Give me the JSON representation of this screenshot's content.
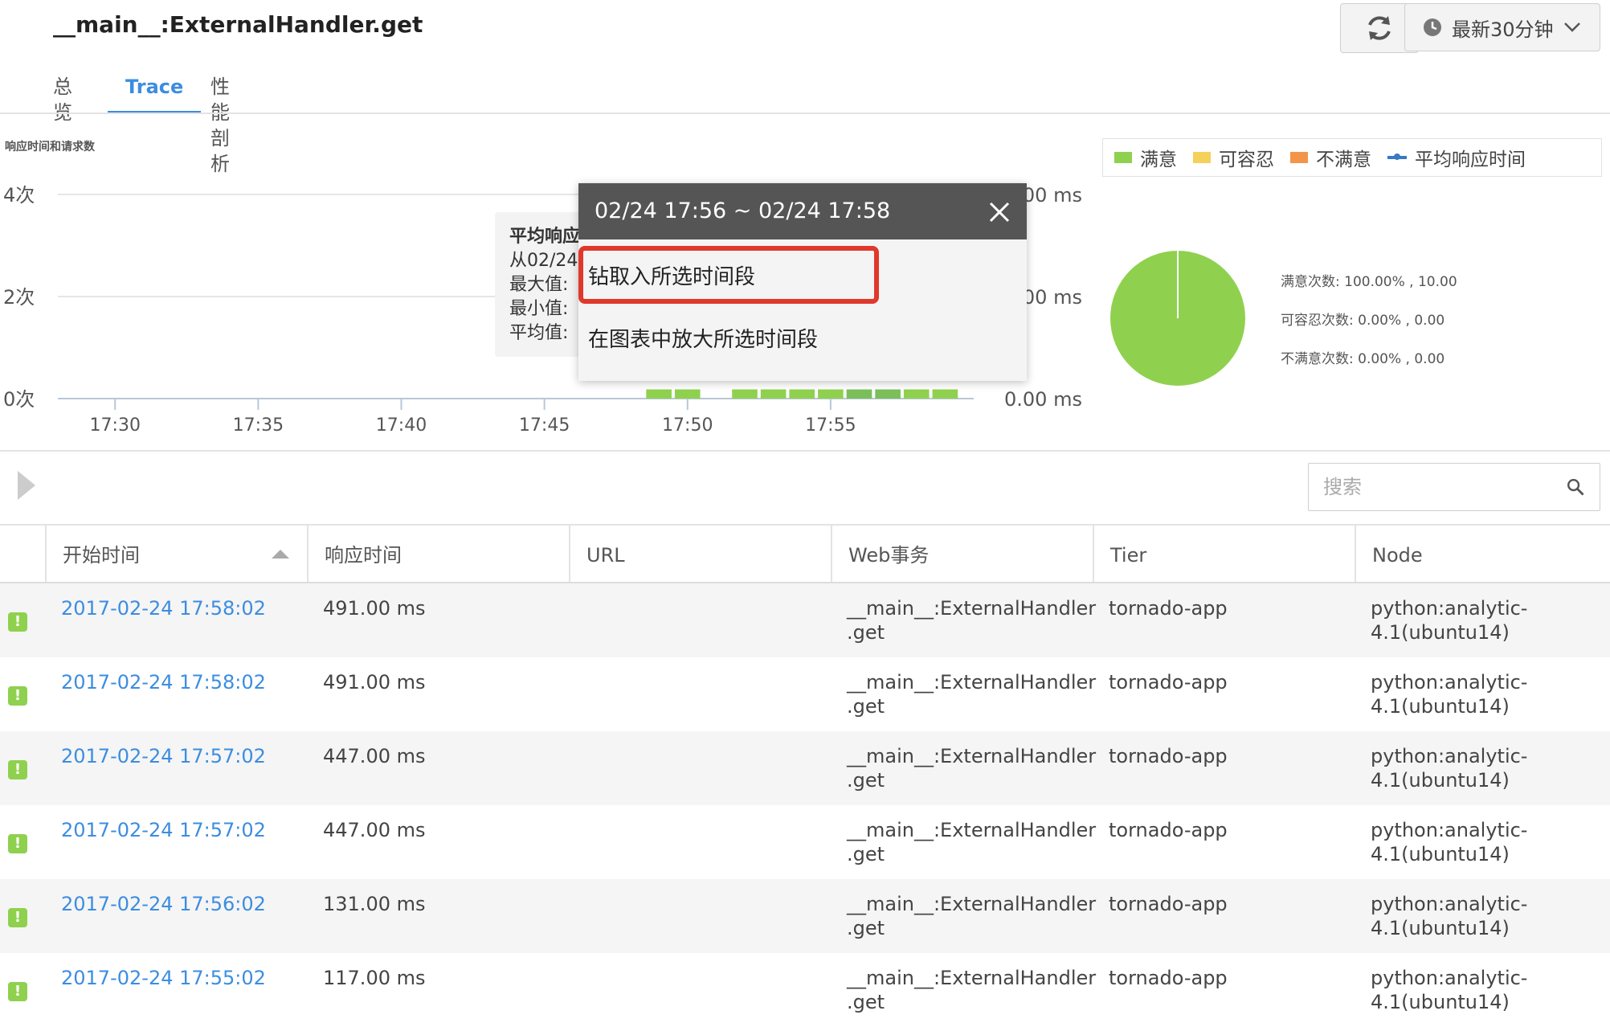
{
  "header": {
    "title": "__main__:ExternalHandler.get",
    "refresh_icon": "refresh-icon",
    "time_range_label": "最新30分钟"
  },
  "tabs": [
    {
      "label": "总览"
    },
    {
      "label": "Trace",
      "active": true
    },
    {
      "label": "性能剖析"
    }
  ],
  "chart": {
    "title": "响应时间和请求数",
    "legend": [
      {
        "label": "满意",
        "color": "#8fd14f"
      },
      {
        "label": "可容忍",
        "color": "#f5d05a"
      },
      {
        "label": "不满意",
        "color": "#f2954a"
      },
      {
        "label": "平均响应时间",
        "color": "#3a78c4"
      }
    ],
    "pie_stats": [
      "满意次数: 100.00% , 10.00",
      "可容忍次数: 0.00% , 0.00",
      "不满意次数: 0.00% , 0.00"
    ]
  },
  "chart_data": {
    "type": "bar",
    "title": "响应时间和请求数",
    "x_ticks": [
      "17:30",
      "17:35",
      "17:40",
      "17:45",
      "17:50",
      "17:55"
    ],
    "left_ticks": [
      "4次",
      "2次",
      "0次"
    ],
    "right_ticks": [
      "0.00 ms",
      "0.00 ms",
      "0.00 ms"
    ],
    "bar_color": "#8fd14f",
    "selected_bar_color": "#7bbf5a",
    "bars": [
      {
        "x": "17:49",
        "value": 1
      },
      {
        "x": "17:50",
        "value": 1
      },
      {
        "x": "17:52",
        "value": 1
      },
      {
        "x": "17:53",
        "value": 1
      },
      {
        "x": "17:54",
        "value": 1
      },
      {
        "x": "17:55",
        "value": 1
      },
      {
        "x": "17:56",
        "value": 1,
        "selected": true
      },
      {
        "x": "17:57",
        "value": 1,
        "selected": true
      },
      {
        "x": "17:58",
        "value": 1
      },
      {
        "x": "17:59",
        "value": 1
      }
    ],
    "pie": [
      {
        "label": "满意",
        "value": 100.0,
        "color": "#8fd14f"
      },
      {
        "label": "可容忍",
        "value": 0.0,
        "color": "#f5d05a"
      },
      {
        "label": "不满意",
        "value": 0.0,
        "color": "#f2954a"
      }
    ]
  },
  "hover_tooltip": {
    "head": "平均响应",
    "lines": [
      "从02/24",
      "最大值:",
      "最小值:",
      "平均值:"
    ]
  },
  "popup": {
    "title": "02/24 17:56 ~ 02/24 17:58",
    "items": [
      "钻取入所选时间段",
      "在图表中放大所选时间段"
    ]
  },
  "search": {
    "placeholder": "搜索"
  },
  "table": {
    "columns": [
      "开始时间",
      "响应时间",
      "URL",
      "Web事务",
      "Tier",
      "Node"
    ],
    "rows": [
      {
        "time": "2017-02-24 17:58:02",
        "response": "491.00 ms",
        "url": "",
        "tx1": "__main__:ExternalHandler",
        "tx2": ".get",
        "tier": "tornado-app",
        "node1": "python:analytic-",
        "node2": "4.1(ubuntu14)"
      },
      {
        "time": "2017-02-24 17:58:02",
        "response": "491.00 ms",
        "url": "",
        "tx1": "__main__:ExternalHandler",
        "tx2": ".get",
        "tier": "tornado-app",
        "node1": "python:analytic-",
        "node2": "4.1(ubuntu14)"
      },
      {
        "time": "2017-02-24 17:57:02",
        "response": "447.00 ms",
        "url": "",
        "tx1": "__main__:ExternalHandler",
        "tx2": ".get",
        "tier": "tornado-app",
        "node1": "python:analytic-",
        "node2": "4.1(ubuntu14)"
      },
      {
        "time": "2017-02-24 17:57:02",
        "response": "447.00 ms",
        "url": "",
        "tx1": "__main__:ExternalHandler",
        "tx2": ".get",
        "tier": "tornado-app",
        "node1": "python:analytic-",
        "node2": "4.1(ubuntu14)"
      },
      {
        "time": "2017-02-24 17:56:02",
        "response": "131.00 ms",
        "url": "",
        "tx1": "__main__:ExternalHandler",
        "tx2": ".get",
        "tier": "tornado-app",
        "node1": "python:analytic-",
        "node2": "4.1(ubuntu14)"
      },
      {
        "time": "2017-02-24 17:55:02",
        "response": "117.00 ms",
        "url": "",
        "tx1": "__main__:ExternalHandler",
        "tx2": ".get",
        "tier": "tornado-app",
        "node1": "python:analytic-",
        "node2": "4.1(ubuntu14)"
      }
    ]
  }
}
